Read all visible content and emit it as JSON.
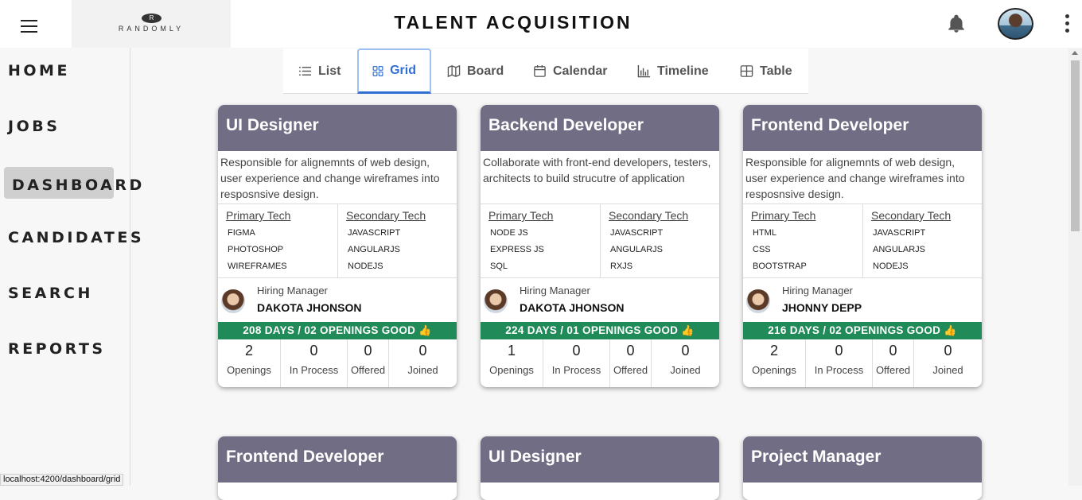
{
  "header": {
    "logo_text": "RANDOMLY",
    "logo_mark": "R",
    "title": "TALENT ACQUISITION"
  },
  "sidebar": {
    "items": [
      {
        "label": "HOME",
        "active": false
      },
      {
        "label": "JOBS",
        "active": false
      },
      {
        "label": "DASHBOARD",
        "active": true
      },
      {
        "label": "CANDIDATES",
        "active": false
      },
      {
        "label": "SEARCH",
        "active": false
      },
      {
        "label": "REPORTS",
        "active": false
      }
    ]
  },
  "views": {
    "tabs": [
      {
        "label": "List",
        "icon": "list-icon"
      },
      {
        "label": "Grid",
        "icon": "grid-icon",
        "active": true
      },
      {
        "label": "Board",
        "icon": "board-icon"
      },
      {
        "label": "Calendar",
        "icon": "calendar-icon"
      },
      {
        "label": "Timeline",
        "icon": "timeline-icon"
      },
      {
        "label": "Table",
        "icon": "table-icon"
      }
    ]
  },
  "labels": {
    "primary_tech": "Primary Tech",
    "secondary_tech": "Secondary Tech",
    "hiring_manager": "Hiring Manager",
    "openings": "Openings",
    "in_process": "In Process",
    "offered": "Offered",
    "joined": "Joined",
    "thumb": "👍"
  },
  "cards": [
    {
      "title": "UI Designer",
      "description": "Responsible for alignemnts of web design, user experience and change wireframes into resposnsive design.",
      "primary_tech": [
        "FIGMA",
        "PHOTOSHOP",
        "WIREFRAMES"
      ],
      "secondary_tech": [
        "JAVASCRIPT",
        "ANGULARJS",
        "NODEJS"
      ],
      "hiring_manager": "DAKOTA JHONSON",
      "status": "208 DAYS / 02 OPENINGS GOOD",
      "openings": "2",
      "in_process": "0",
      "offered": "0",
      "joined": "0"
    },
    {
      "title": "Backend Developer",
      "description": "Collaborate with front-end developers, testers, architects to build strucutre of application",
      "primary_tech": [
        "NODE JS",
        "EXPRESS JS",
        "SQL"
      ],
      "secondary_tech": [
        "JAVASCRIPT",
        "ANGULARJS",
        "RXJS"
      ],
      "hiring_manager": "DAKOTA JHONSON",
      "status": "224 DAYS / 01 OPENINGS GOOD",
      "openings": "1",
      "in_process": "0",
      "offered": "0",
      "joined": "0"
    },
    {
      "title": "Frontend Developer",
      "description": "Responsible for alignemnts of web design, user experience and change wireframes into resposnsive design.",
      "primary_tech": [
        "HTML",
        "CSS",
        "BOOTSTRAP"
      ],
      "secondary_tech": [
        "JAVASCRIPT",
        "ANGULARJS",
        "NODEJS"
      ],
      "hiring_manager": "JHONNY DEPP",
      "status": "216 DAYS / 02 OPENINGS GOOD",
      "openings": "2",
      "in_process": "0",
      "offered": "0",
      "joined": "0"
    }
  ],
  "cards_row2": [
    {
      "title": "Frontend Developer"
    },
    {
      "title": "UI Designer"
    },
    {
      "title": "Project Manager"
    }
  ],
  "status_bar": {
    "url": "localhost:4200/dashboard/grid"
  },
  "colors": {
    "card_header": "#716d84",
    "status_good": "#208a58",
    "active_tab": "#2f6fd6"
  }
}
